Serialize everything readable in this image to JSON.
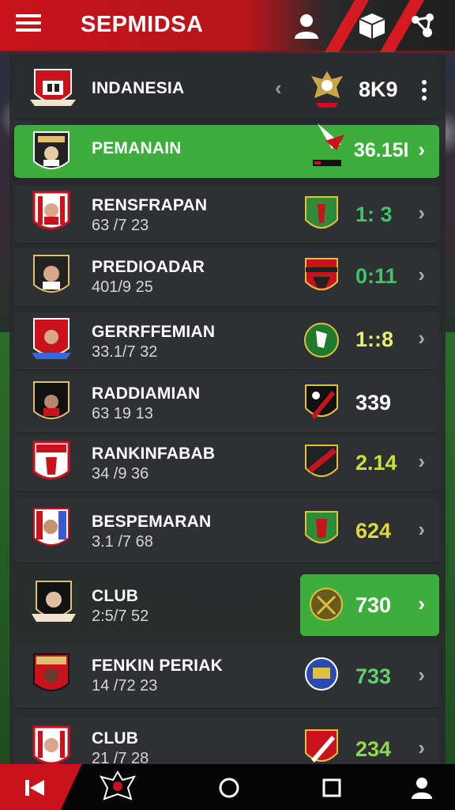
{
  "app": {
    "title": "SEPMIDSA"
  },
  "header_row": {
    "country": "INDANESIA",
    "value": "8K9"
  },
  "rows": [
    {
      "name": "PEMANAIN",
      "sub": "",
      "score": "36.15l",
      "score_color": "#ffffff",
      "highlight": true
    },
    {
      "name": "RENSFRAPAN",
      "sub": "63 /7 23",
      "score": "1: 3",
      "score_color": "#3fc46a"
    },
    {
      "name": "PREDIOADAR",
      "sub": "401/9 25",
      "score": "0:11",
      "score_color": "#3fc46a"
    },
    {
      "name": "GERRFFEMIAN",
      "sub": "33.1/7 32",
      "score": "1::8",
      "score_color": "#e6f06a"
    },
    {
      "name": "RADDIAMIAN",
      "sub": "63 19 13",
      "score": "339",
      "score_color": "#ffffff"
    },
    {
      "name": "RANKINFABAB",
      "sub": "34 /9 36",
      "score": "2.14",
      "score_color": "#c9e23a"
    },
    {
      "name": "BESPEMARAN",
      "sub": "3.1 /7 68",
      "score": "624",
      "score_color": "#e0d93a"
    },
    {
      "name": "CLUB",
      "sub": "2:5/7 52",
      "score": "730",
      "score_color": "#ffffff",
      "green_box": true
    },
    {
      "name": "FENKIN PERIAK",
      "sub": "14 /72 23",
      "score": "733",
      "score_color": "#5fd36a"
    },
    {
      "name": "CLUB",
      "sub": "21 /7 28",
      "score": "234",
      "score_color": "#8fd94a"
    }
  ],
  "colors": {
    "brand_red": "#c8131c",
    "accent_green": "#3dae3e"
  },
  "icons": {
    "menu": "menu-icon",
    "user": "user-icon",
    "box": "cube-icon",
    "share": "share-icon",
    "back": "chevron-left-icon",
    "more": "more-vertical-icon",
    "row_chevron": "chevron-right-icon",
    "nav_back": "rewind-icon",
    "nav_home": "home-circle-icon",
    "nav_recents": "square-icon",
    "nav_profile": "user-icon"
  },
  "glyphs": {
    "back": "‹",
    "chev": "›"
  }
}
